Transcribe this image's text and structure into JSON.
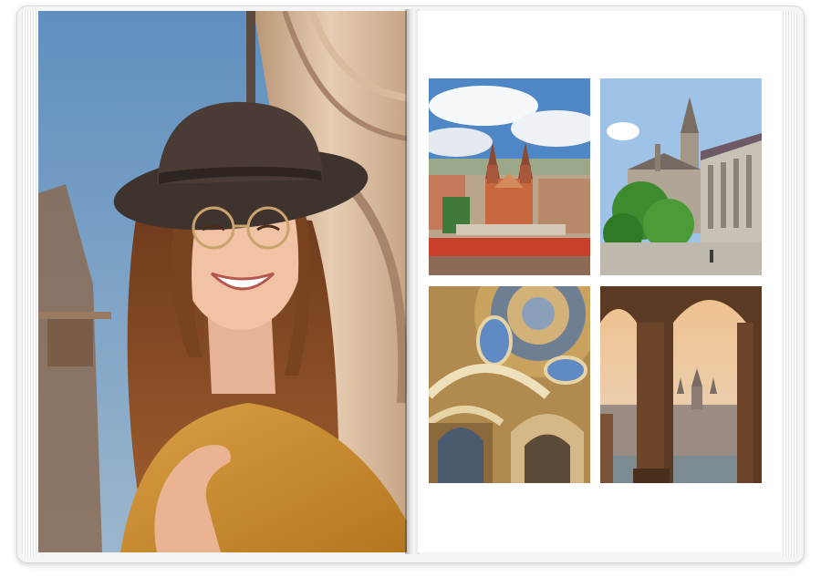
{
  "book": {
    "left_page": {
      "photo": "portrait-woman-in-hat-laughing"
    },
    "right_page": {
      "photos": [
        {
          "subject": "aerial-city-cathedral"
        },
        {
          "subject": "church-tower-with-trees"
        },
        {
          "subject": "ornate-dome-ceiling"
        },
        {
          "subject": "arches-overlooking-parliament"
        }
      ]
    }
  },
  "colors": {
    "sky": "#6b93b8",
    "hat": "#3f332e",
    "hair": "#8a4a24",
    "shirt": "#c8892e",
    "stone": "#c9a98a"
  }
}
